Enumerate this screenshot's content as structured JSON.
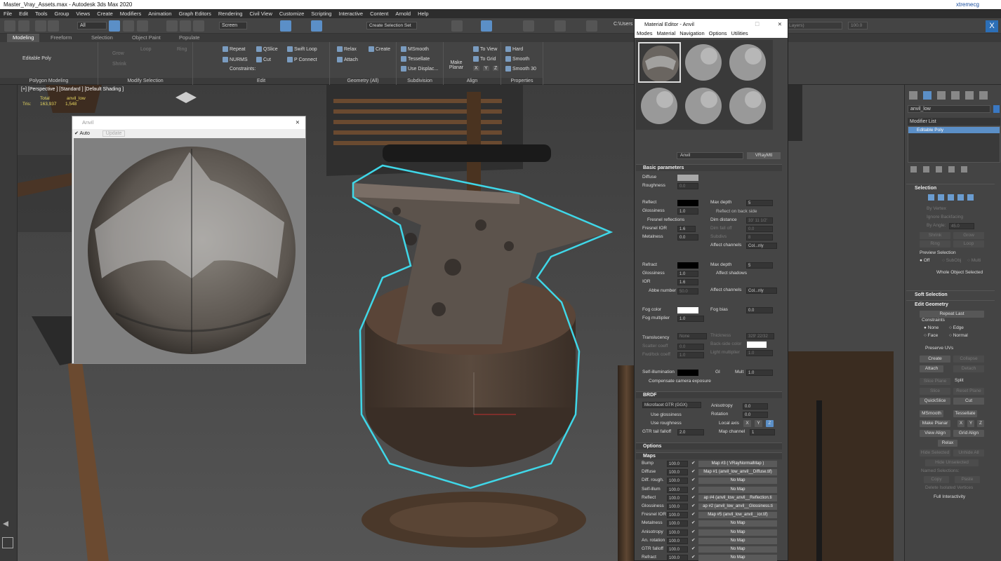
{
  "window": {
    "title": "Master_Vray_Assets.max - Autodesk 3ds Max 2020",
    "user": "xtremecg"
  },
  "menu": [
    "File",
    "Edit",
    "Tools",
    "Group",
    "Views",
    "Create",
    "Modifiers",
    "Animation",
    "Graph Editors",
    "Rendering",
    "Civil View",
    "Customize",
    "Scripting",
    "Interactive",
    "Content",
    "Arnold",
    "Help"
  ],
  "toolbar": {
    "filter": "All",
    "ref_coord": "Screen",
    "selection_set": "Create Selection Set",
    "path": "C:\\Users",
    "layers": "Layers)",
    "zoom": "100.0"
  },
  "ribbon": {
    "tabs": [
      "Modeling",
      "Freeform",
      "Selection",
      "Object Paint",
      "Populate"
    ],
    "object_type": "Editable Poly",
    "grow": "Grow",
    "shrink": "Shrink",
    "loop": "Loop",
    "ring": "Ring",
    "edit": [
      "Repeat",
      "QSlice",
      "Swift Loop",
      "NURMS",
      "Cut",
      "P Connect",
      "Constraints:"
    ],
    "geometry": [
      "Relax",
      "Create",
      "Attach"
    ],
    "subdivision": [
      "MSmooth",
      "Tessellate",
      "Use Displac..."
    ],
    "align": [
      "Make Planar",
      "To View",
      "To Grid",
      "X",
      "Y",
      "Z"
    ],
    "properties": [
      "Hard",
      "Smooth",
      "Smooth 30"
    ],
    "groups": [
      "Polygon Modeling",
      "Modify Selection",
      "Edit",
      "Geometry (All)",
      "Subdivision",
      "Align",
      "Properties"
    ]
  },
  "viewport": {
    "label": "[+] [Perspective ] [Standard ] [Default Shading ]",
    "stats": {
      "total_label": "Total",
      "object": "anvil_low",
      "tris_label": "Tris:",
      "tris_total": "163,937",
      "tris_obj": "1,548"
    }
  },
  "preview": {
    "title": "Anvil",
    "auto": "Auto",
    "update": "Update"
  },
  "material_editor": {
    "title": "Material Editor - Anvil",
    "menu": [
      "Modes",
      "Material",
      "Navigation",
      "Options",
      "Utilities"
    ],
    "name": "Anvil",
    "type": "VRayMtl",
    "basic": {
      "header": "Basic parameters",
      "diffuse": "Diffuse",
      "roughness": "Roughness",
      "roughness_val": "0.0",
      "reflect": "Reflect",
      "glossiness": "Glossiness",
      "gloss_val": "1.0",
      "max_depth": "Max depth",
      "max_depth_val": "5",
      "reflect_backside": "Reflect on back side",
      "fresnel": "Fresnel reflections",
      "dim_distance": "Dim distance",
      "dim_val": "33' 11 1/2'",
      "fresnel_ior": "Fresnel IOR",
      "fresnel_ior_val": "1.6",
      "dim_falloff": "Dim fall off",
      "dim_falloff_val": "0.0",
      "metalness": "Metalness",
      "metal_val": "0.0",
      "subdivs": "Subdivs",
      "subdivs_val": "8",
      "affect_channels": "Affect channels",
      "channels_val": "Col...nly",
      "refract": "Refract",
      "refr_gloss_val": "1.0",
      "ior": "IOR",
      "ior_val": "1.6",
      "refr_max_depth_val": "5",
      "affect_shadows": "Affect shadows",
      "abbe": "Abbe number",
      "abbe_val": "50.0",
      "fog_color": "Fog color",
      "fog_bias": "Fog bias",
      "fog_bias_val": "0.0",
      "fog_mult": "Fog multiplier",
      "fog_mult_val": "1.0",
      "translucency": "Translucency",
      "transl_val": "None",
      "thickness": "Thickness",
      "thickness_val": "329' 22/32",
      "scatter": "Scatter coeff",
      "scatter_val": "0.0",
      "backside": "Back-side color",
      "fwd_bck": "Fwd/bck coeff",
      "fwd_val": "1.0",
      "light_mult": "Light multiplier",
      "light_val": "1.0",
      "self_illum": "Self-illumination",
      "gi": "GI",
      "mult": "Mult",
      "mult_val": "1.0",
      "compensate": "Compensate camera exposure"
    },
    "brdf": {
      "header": "BRDF",
      "type": "Microfacet GTR (GGX)",
      "anisotropy": "Anisotropy",
      "aniso_val": "0.0",
      "rotation": "Rotation",
      "rot_val": "0.0",
      "use_gloss": "Use glossiness",
      "use_rough": "Use roughness",
      "local_axis": "Local axis",
      "map_channel": "Map channel",
      "map_ch_val": "1",
      "gtr_falloff": "GTR tail falloff",
      "gtr_val": "2.0",
      "axes": [
        "X",
        "Y",
        "Z"
      ]
    },
    "options_header": "Options",
    "maps_header": "Maps",
    "maps": [
      {
        "name": "Bump",
        "amount": "100.0",
        "map": "Map #3  ( VRayNormalMap )"
      },
      {
        "name": "Diffuse",
        "amount": "100.0",
        "map": "Map #1 (anvil_low_anvil__Diffuse.tif)"
      },
      {
        "name": "Diff. rough.",
        "amount": "100.0",
        "map": "No Map"
      },
      {
        "name": "Self-illum",
        "amount": "100.0",
        "map": "No Map"
      },
      {
        "name": "Reflect",
        "amount": "100.0",
        "map": "ap #4 (anvil_low_anvil__Reflection.ti"
      },
      {
        "name": "Glossiness",
        "amount": "100.0",
        "map": "ap #2 (anvil_low_anvil__Glossiness.ti"
      },
      {
        "name": "Fresnel IOR",
        "amount": "100.0",
        "map": "Map #5 (anvil_low_anvil__ior.tif)"
      },
      {
        "name": "Metalness",
        "amount": "100.0",
        "map": "No Map"
      },
      {
        "name": "Anisotropy",
        "amount": "100.0",
        "map": "No Map"
      },
      {
        "name": "An. rotation",
        "amount": "100.0",
        "map": "No Map"
      },
      {
        "name": "GTR falloff",
        "amount": "100.0",
        "map": "No Map"
      },
      {
        "name": "Refract",
        "amount": "100.0",
        "map": "No Map"
      }
    ]
  },
  "command_panel": {
    "object_name": "anvil_low",
    "modifier_list": "Modifier List",
    "stack_item": "Editable Poly",
    "selection": {
      "header": "Selection",
      "by_vertex": "By Vertex",
      "ignore_backfacing": "Ignore Backfacing",
      "by_angle": "By Angle:",
      "angle_val": "45.0",
      "shrink": "Shrink",
      "grow": "Grow",
      "ring": "Ring",
      "loop": "Loop",
      "preview": "Preview Selection",
      "off": "Off",
      "subobj": "SubObj",
      "multi": "Multi",
      "whole": "Whole Object Selected"
    },
    "soft_selection": "Soft Selection",
    "edit_geometry": {
      "header": "Edit Geometry",
      "repeat_last": "Repeat Last",
      "constraints": "Constraints",
      "none": "None",
      "edge": "Edge",
      "face": "Face",
      "normal": "Normal",
      "preserve_uvs": "Preserve UVs",
      "create": "Create",
      "collapse": "Collapse",
      "attach": "Attach",
      "detach": "Detach",
      "slice_plane": "Slice Plane",
      "split": "Split",
      "slice": "Slice",
      "reset_plane": "Reset Plane",
      "quickslice": "QuickSlice",
      "cut": "Cut",
      "msmooth": "MSmooth",
      "tessellate": "Tessellate",
      "make_planar": "Make Planar",
      "x": "X",
      "y": "Y",
      "z": "Z",
      "view_align": "View Align",
      "grid_align": "Grid Align",
      "relax": "Relax",
      "hide_selected": "Hide Selected",
      "unhide_all": "Unhide All",
      "hide_unselected": "Hide Unselected",
      "named_sel": "Named Selections:",
      "copy": "Copy",
      "paste": "Paste",
      "delete_isolated": "Delete Isolated Vertices",
      "full_interactivity": "Full Interactivity"
    }
  },
  "colors": {
    "accent": "#5b8fc7",
    "outline": "#3fd7e8",
    "wood": "#5e4632",
    "metal": "#6b6560"
  }
}
